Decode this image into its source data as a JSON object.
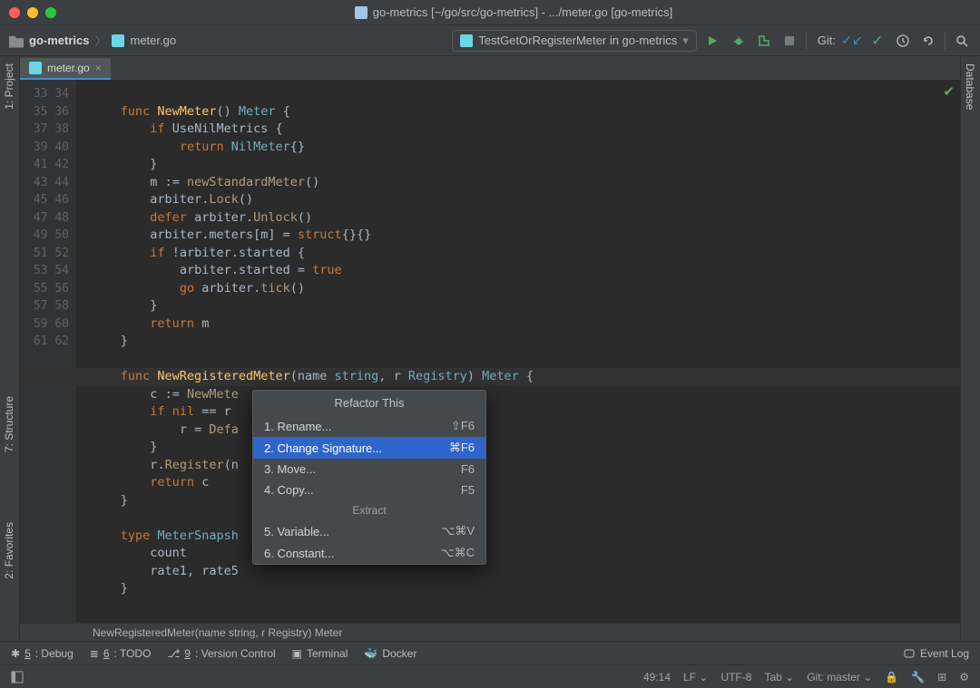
{
  "title": "go-metrics [~/go/src/go-metrics] - .../meter.go [go-metrics]",
  "breadcrumb": {
    "project": "go-metrics",
    "file": "meter.go"
  },
  "run_config": "TestGetOrRegisterMeter in go-metrics",
  "git_label": "Git:",
  "tab": {
    "name": "meter.go"
  },
  "left_tools": [
    "1: Project",
    "7: Structure",
    "2: Favorites"
  ],
  "right_tools": [
    "Database"
  ],
  "gutter_start": 33,
  "gutter_end": 62,
  "code": {
    "lines": [
      {
        "n": 33,
        "t": ""
      },
      {
        "n": 34,
        "t": "func NewMeter() Meter {",
        "tokens": [
          [
            "kw",
            "func "
          ],
          [
            "fn",
            "NewMeter"
          ],
          [
            "p",
            "() "
          ],
          [
            "ty",
            "Meter"
          ],
          [
            "p",
            " {"
          ]
        ]
      },
      {
        "n": 35,
        "t": "    if UseNilMetrics {",
        "tokens": [
          [
            "p",
            "    "
          ],
          [
            "kw",
            "if "
          ],
          [
            "id",
            "UseNilMetrics "
          ],
          [
            "p",
            "{"
          ]
        ]
      },
      {
        "n": 36,
        "t": "        return NilMeter{}",
        "tokens": [
          [
            "p",
            "        "
          ],
          [
            "kw",
            "return "
          ],
          [
            "ty",
            "NilMeter"
          ],
          [
            "p",
            "{}"
          ]
        ]
      },
      {
        "n": 37,
        "t": "    }",
        "tokens": [
          [
            "p",
            "    }"
          ]
        ]
      },
      {
        "n": 38,
        "t": "    m := newStandardMeter()",
        "tokens": [
          [
            "p",
            "    "
          ],
          [
            "id",
            "m "
          ],
          [
            "op",
            ":= "
          ],
          [
            "fn2",
            "newStandardMeter"
          ],
          [
            "p",
            "()"
          ]
        ]
      },
      {
        "n": 39,
        "t": "    arbiter.Lock()",
        "tokens": [
          [
            "p",
            "    "
          ],
          [
            "id",
            "arbiter"
          ],
          [
            "p",
            "."
          ],
          [
            "fn2",
            "Lock"
          ],
          [
            "p",
            "()"
          ]
        ]
      },
      {
        "n": 40,
        "t": "    defer arbiter.Unlock()",
        "tokens": [
          [
            "p",
            "    "
          ],
          [
            "kw",
            "defer "
          ],
          [
            "id",
            "arbiter"
          ],
          [
            "p",
            "."
          ],
          [
            "fn2",
            "Unlock"
          ],
          [
            "p",
            "()"
          ]
        ]
      },
      {
        "n": 41,
        "t": "    arbiter.meters[m] = struct{}{}",
        "tokens": [
          [
            "p",
            "    "
          ],
          [
            "id",
            "arbiter"
          ],
          [
            "p",
            "."
          ],
          [
            "id",
            "meters"
          ],
          [
            "p",
            "["
          ],
          [
            "id",
            "m"
          ],
          [
            "p",
            "] = "
          ],
          [
            "kw",
            "struct"
          ],
          [
            "p",
            "{}{}"
          ]
        ]
      },
      {
        "n": 42,
        "t": "    if !arbiter.started {",
        "tokens": [
          [
            "p",
            "    "
          ],
          [
            "kw",
            "if "
          ],
          [
            "p",
            "!"
          ],
          [
            "id",
            "arbiter"
          ],
          [
            "p",
            "."
          ],
          [
            "id",
            "started "
          ],
          [
            "p",
            "{"
          ]
        ]
      },
      {
        "n": 43,
        "t": "        arbiter.started = true",
        "tokens": [
          [
            "p",
            "        "
          ],
          [
            "id",
            "arbiter"
          ],
          [
            "p",
            "."
          ],
          [
            "id",
            "started"
          ],
          [
            "p",
            " = "
          ],
          [
            "lit",
            "true"
          ]
        ]
      },
      {
        "n": 44,
        "t": "        go arbiter.tick()",
        "tokens": [
          [
            "p",
            "        "
          ],
          [
            "kw",
            "go "
          ],
          [
            "id",
            "arbiter"
          ],
          [
            "p",
            "."
          ],
          [
            "fn2",
            "tick"
          ],
          [
            "p",
            "()"
          ]
        ]
      },
      {
        "n": 45,
        "t": "    }",
        "tokens": [
          [
            "p",
            "    }"
          ]
        ]
      },
      {
        "n": 46,
        "t": "    return m",
        "tokens": [
          [
            "p",
            "    "
          ],
          [
            "kw",
            "return "
          ],
          [
            "id",
            "m"
          ]
        ]
      },
      {
        "n": 47,
        "t": "}",
        "tokens": [
          [
            "p",
            "}"
          ]
        ]
      },
      {
        "n": 48,
        "t": ""
      },
      {
        "n": 49,
        "hl": true,
        "t": "func NewRegisteredMeter(name string, r Registry) Meter {",
        "tokens": [
          [
            "kw",
            "func "
          ],
          [
            "fn",
            "NewRegisteredMeter"
          ],
          [
            "p",
            "("
          ],
          [
            "id",
            "name "
          ],
          [
            "ty",
            "string"
          ],
          [
            "p",
            ", "
          ],
          [
            "id",
            "r "
          ],
          [
            "ty",
            "Registry"
          ],
          [
            "p",
            ") "
          ],
          [
            "ty",
            "Meter"
          ],
          [
            "p",
            " {"
          ]
        ]
      },
      {
        "n": 50,
        "t": "    c := NewMete",
        "tokens": [
          [
            "p",
            "    "
          ],
          [
            "id",
            "c "
          ],
          [
            "op",
            ":= "
          ],
          [
            "fn2",
            "NewMete"
          ]
        ]
      },
      {
        "n": 51,
        "t": "    if nil == r",
        "tokens": [
          [
            "p",
            "    "
          ],
          [
            "kw",
            "if "
          ],
          [
            "lit",
            "nil"
          ],
          [
            "p",
            " == "
          ],
          [
            "id",
            "r "
          ]
        ]
      },
      {
        "n": 52,
        "t": "        r = Defa",
        "tokens": [
          [
            "p",
            "        "
          ],
          [
            "id",
            "r"
          ],
          [
            "p",
            " = "
          ],
          [
            "fn2",
            "Defa"
          ]
        ]
      },
      {
        "n": 53,
        "t": "    }",
        "tokens": [
          [
            "p",
            "    }"
          ]
        ]
      },
      {
        "n": 54,
        "t": "    r.Register(n",
        "tokens": [
          [
            "p",
            "    "
          ],
          [
            "id",
            "r"
          ],
          [
            "p",
            "."
          ],
          [
            "fn2",
            "Register"
          ],
          [
            "p",
            "("
          ],
          [
            "id",
            "n"
          ]
        ]
      },
      {
        "n": 55,
        "t": "    return c",
        "tokens": [
          [
            "p",
            "    "
          ],
          [
            "kw",
            "return "
          ],
          [
            "id",
            "c"
          ]
        ]
      },
      {
        "n": 56,
        "t": "}",
        "tokens": [
          [
            "p",
            "}"
          ]
        ]
      },
      {
        "n": 57,
        "t": ""
      },
      {
        "n": 58,
        "t": "type MeterSnapsh",
        "tokens": [
          [
            "kw",
            "type "
          ],
          [
            "ty",
            "MeterSnapsh"
          ]
        ]
      },
      {
        "n": 59,
        "t": "    count",
        "tokens": [
          [
            "p",
            "    "
          ],
          [
            "id",
            "count"
          ]
        ]
      },
      {
        "n": 60,
        "t": "    rate1, rate5",
        "tokens": [
          [
            "p",
            "    "
          ],
          [
            "id",
            "rate1"
          ],
          [
            "p",
            ", "
          ],
          [
            "id",
            "rate5"
          ]
        ]
      },
      {
        "n": 61,
        "t": "}",
        "tokens": [
          [
            "p",
            "}"
          ]
        ]
      },
      {
        "n": 62,
        "t": ""
      }
    ]
  },
  "breadcrumb_fn": "NewRegisteredMeter(name string, r Registry) Meter",
  "popup": {
    "title": "Refactor This",
    "items": [
      {
        "label": "1. Rename...",
        "key": "⇧F6"
      },
      {
        "label": "2. Change Signature...",
        "key": "⌘F6",
        "sel": true
      },
      {
        "label": "3. Move...",
        "key": "F6"
      },
      {
        "label": "4. Copy...",
        "key": "F5"
      }
    ],
    "section": "Extract",
    "items2": [
      {
        "label": "5. Variable...",
        "key": "⌥⌘V"
      },
      {
        "label": "6. Constant...",
        "key": "⌥⌘C"
      }
    ]
  },
  "bottom_tools": [
    {
      "icon": "bug",
      "u": "5",
      "label": ": Debug"
    },
    {
      "icon": "list",
      "u": "6",
      "label": ": TODO"
    },
    {
      "icon": "branch",
      "u": "9",
      "label": ": Version Control"
    },
    {
      "icon": "term",
      "u": "",
      "label": "Terminal"
    },
    {
      "icon": "docker",
      "u": "",
      "label": "Docker"
    }
  ],
  "event_log": "Event Log",
  "status": {
    "pos": "49:14",
    "le": "LF",
    "enc": "UTF-8",
    "indent": "Tab",
    "branch": "Git: master"
  }
}
